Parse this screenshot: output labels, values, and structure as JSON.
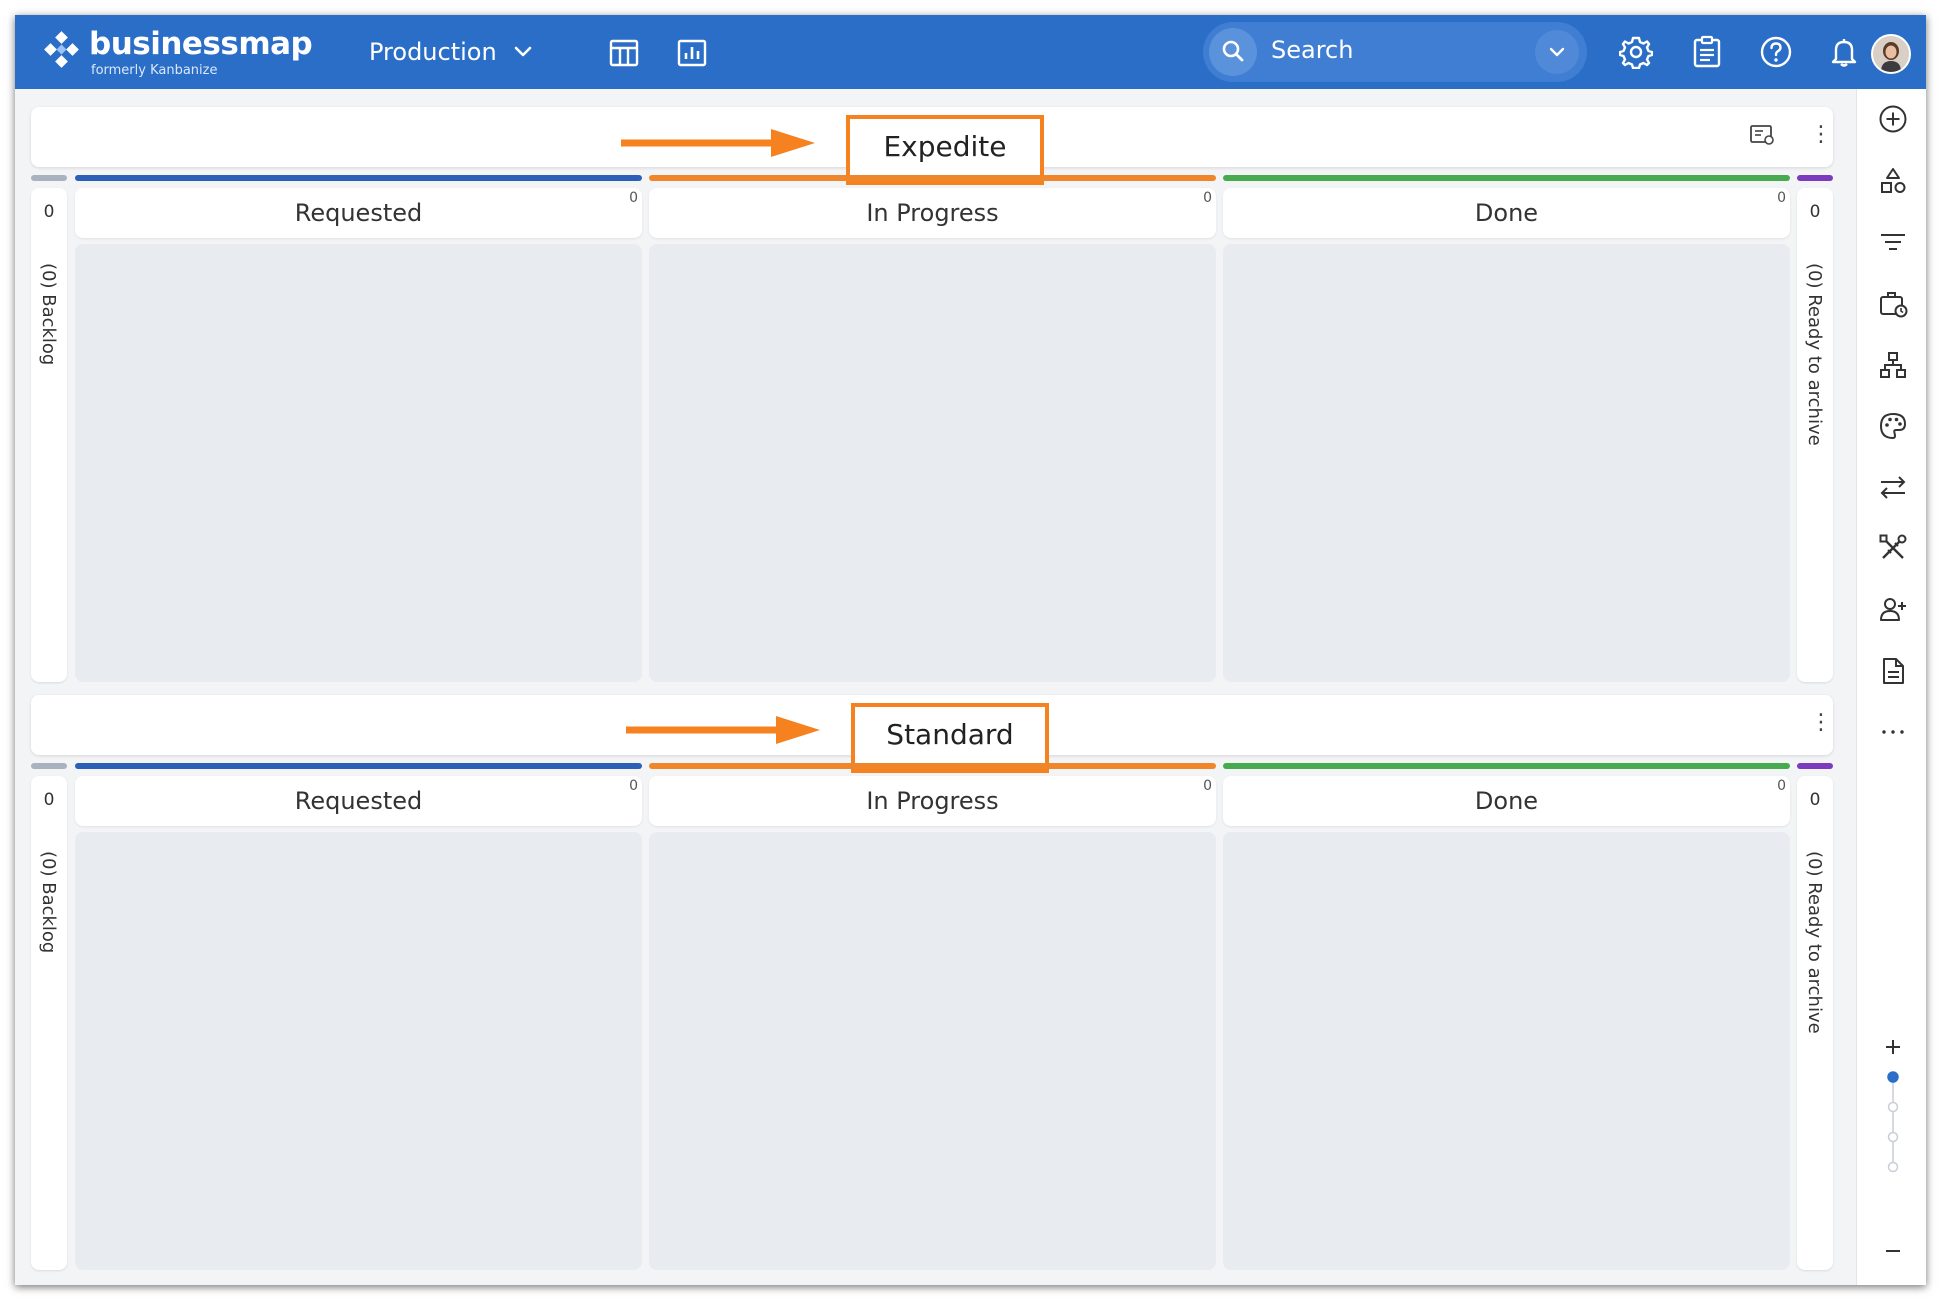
{
  "header": {
    "brand": "businessmap",
    "brand_sub": "formerly Kanbanize",
    "board_name": "Production",
    "search_placeholder": "Search"
  },
  "lanes": [
    {
      "title": "Expedite",
      "backlog": {
        "count": "0",
        "label": "(0) Backlog"
      },
      "archive": {
        "count": "0",
        "label": "(0) Ready to archive"
      },
      "columns": [
        {
          "name": "Requested",
          "count": "0",
          "color": "#2c5fb6"
        },
        {
          "name": "In Progress",
          "count": "0",
          "color": "#f0862a"
        },
        {
          "name": "Done",
          "count": "0",
          "color": "#46ab4e"
        }
      ]
    },
    {
      "title": "Standard",
      "backlog": {
        "count": "0",
        "label": "(0) Backlog"
      },
      "archive": {
        "count": "0",
        "label": "(0) Ready to archive"
      },
      "columns": [
        {
          "name": "Requested",
          "count": "0",
          "color": "#2c5fb6"
        },
        {
          "name": "In Progress",
          "count": "0",
          "color": "#f0862a"
        },
        {
          "name": "Done",
          "count": "0",
          "color": "#46ab4e"
        }
      ]
    }
  ],
  "colors": {
    "topbar": "#2b6ec7",
    "highlight": "#f5821f",
    "backlog_bar": "#a9b3bf",
    "archive_bar": "#7c3bbd"
  },
  "zoom": {
    "levels": 4,
    "active": 1
  }
}
